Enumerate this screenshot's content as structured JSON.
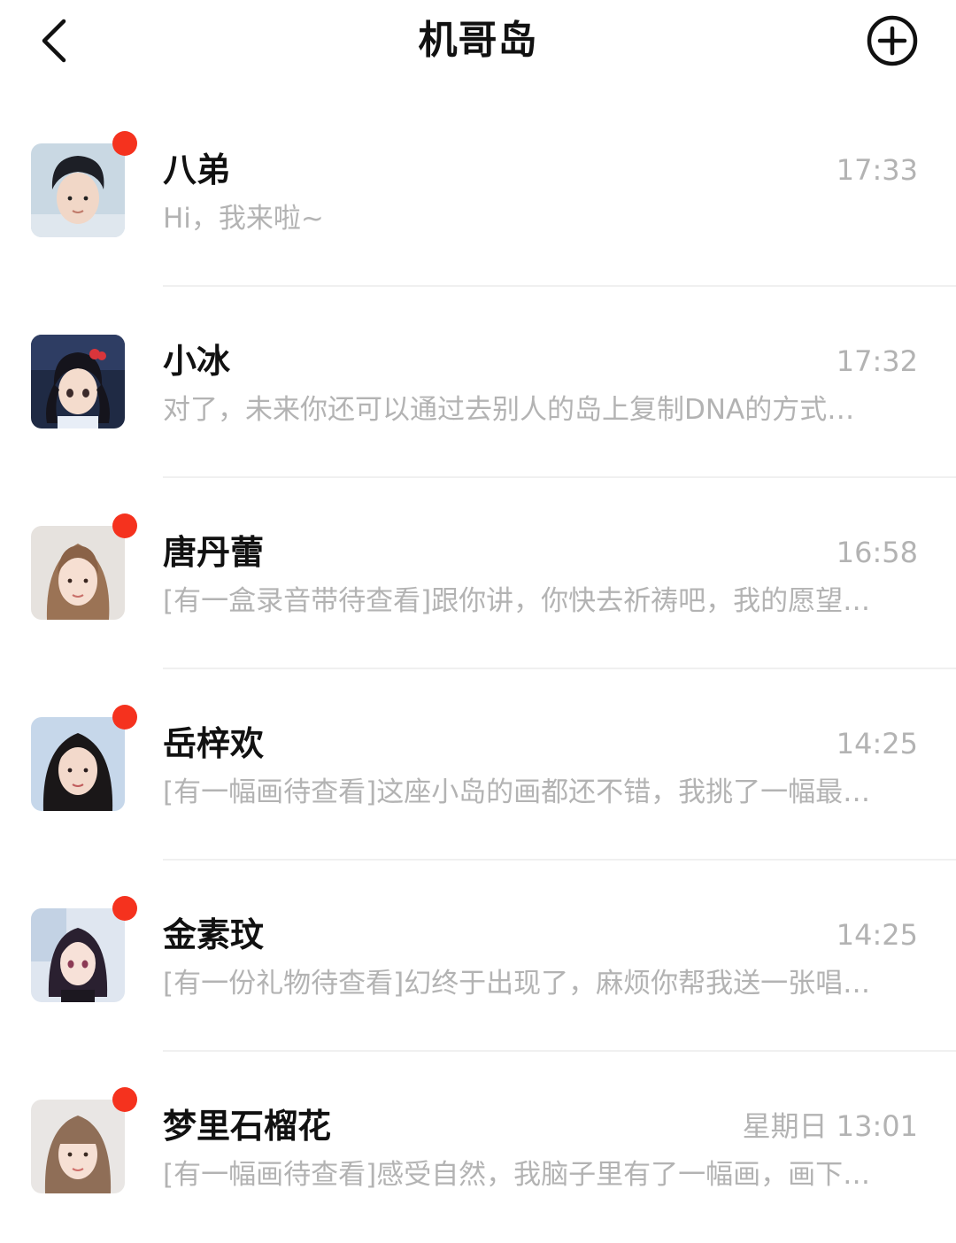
{
  "header": {
    "title": "机哥岛"
  },
  "colors": {
    "unread_dot": "#f5321e",
    "secondary_text": "#b3b3b3",
    "divider": "#f0f0f0"
  },
  "conversations": [
    {
      "name": "八弟",
      "time": "17:33",
      "preview": "Hi，我来啦~",
      "unread": true,
      "avatar": "avatar-young-man-dark-hair"
    },
    {
      "name": "小冰",
      "time": "17:32",
      "preview": "对了，未来你还可以通过去别人的岛上复制DNA的方式…",
      "unread": false,
      "avatar": "avatar-anime-girl-twin-tails"
    },
    {
      "name": "唐丹蕾",
      "time": "16:58",
      "preview": "[有一盒录音带待查看]跟你讲，你快去祈祷吧，我的愿望…",
      "unread": true,
      "avatar": "avatar-woman-light-brown-hair"
    },
    {
      "name": "岳梓欢",
      "time": "14:25",
      "preview": "[有一幅画待查看]这座小岛的画都还不错，我挑了一幅最…",
      "unread": true,
      "avatar": "avatar-woman-dark-hair"
    },
    {
      "name": "金素玟",
      "time": "14:25",
      "preview": "[有一份礼物待查看]幻终于出现了，麻烦你帮我送一张唱…",
      "unread": true,
      "avatar": "avatar-anime-girl-short-hair"
    },
    {
      "name": "梦里石榴花",
      "time": "星期日 13:01",
      "preview": "[有一幅画待查看]感受自然，我脑子里有了一幅画，画下…",
      "unread": true,
      "avatar": "avatar-woman-brown-bangs"
    }
  ]
}
